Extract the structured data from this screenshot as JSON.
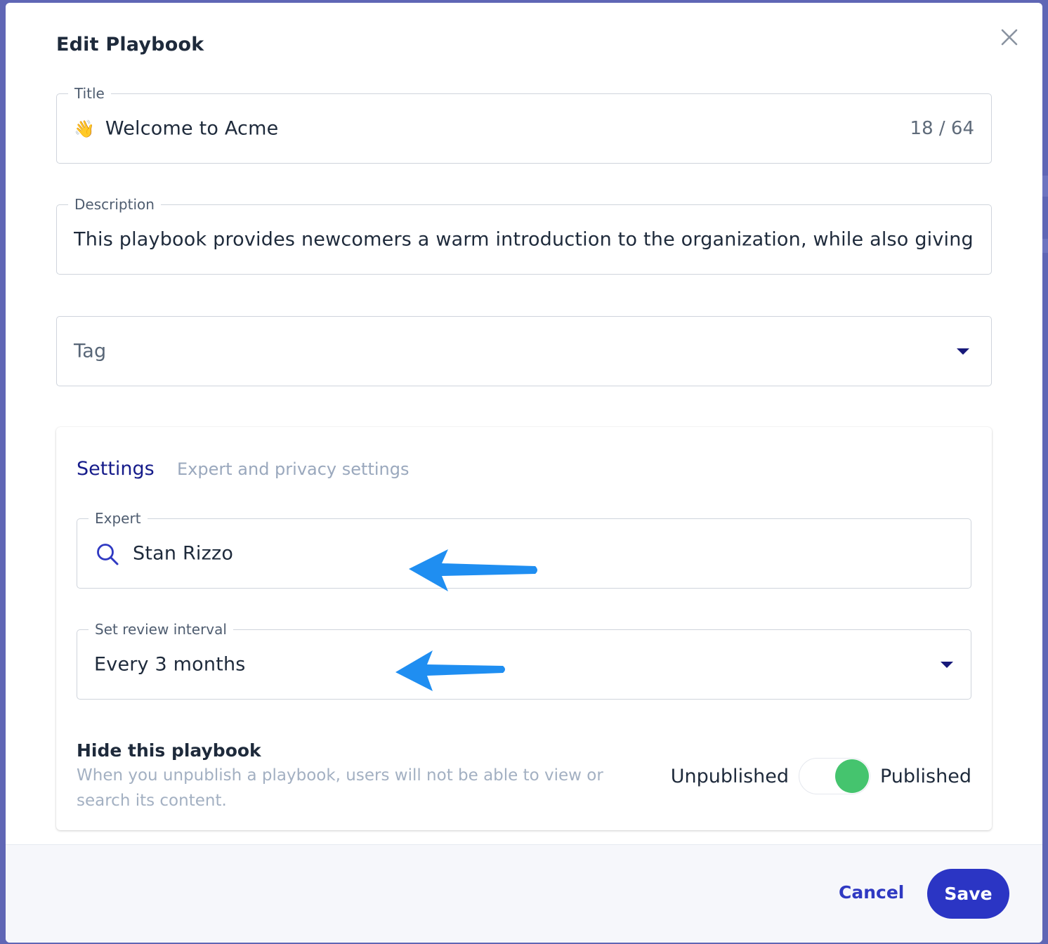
{
  "modal": {
    "title": "Edit Playbook"
  },
  "title_field": {
    "label": "Title",
    "emoji": "👋",
    "value": "Welcome to Acme",
    "counter": "18 / 64"
  },
  "description_field": {
    "label": "Description",
    "value": "This playbook provides newcomers a warm introduction to the organization, while also giving"
  },
  "tag_field": {
    "placeholder": "Tag"
  },
  "settings": {
    "title": "Settings",
    "subtitle": "Expert and privacy settings",
    "expert": {
      "label": "Expert",
      "value": "Stan Rizzo"
    },
    "review_interval": {
      "label": "Set review interval",
      "value": "Every 3 months"
    },
    "visibility": {
      "title": "Hide this playbook",
      "description": "When you unpublish a playbook, users will not be able to view or search its content.",
      "off_label": "Unpublished",
      "on_label": "Published",
      "published": true
    }
  },
  "footer": {
    "cancel_label": "Cancel",
    "save_label": "Save"
  },
  "colors": {
    "accent": "#2b35c4",
    "settings_title": "#151b8a",
    "toggle_on": "#45c46e",
    "annotation_arrow": "#1f8ef1"
  }
}
